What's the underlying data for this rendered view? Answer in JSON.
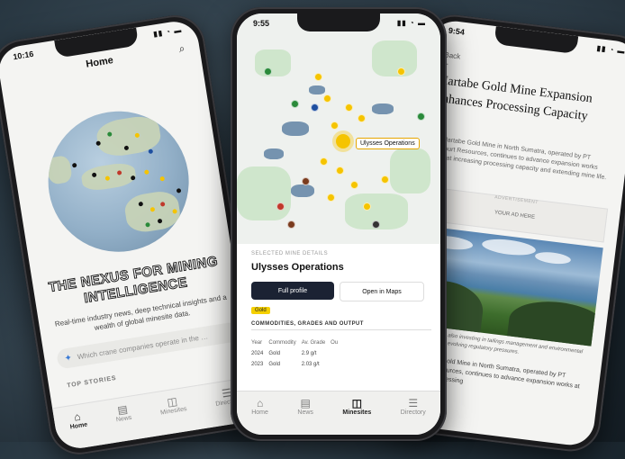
{
  "phone1": {
    "time": "10:16",
    "title": "Home",
    "hero": "THE NEXUS FOR MINING INTELLIGENCE",
    "subtitle": "Real-time industry news, deep technical insights and a wealth of global minesite data.",
    "ask_placeholder": "Which crane companies operate in the …",
    "top_stories": "TOP STORIES",
    "tabs": [
      "Home",
      "News",
      "Minesites",
      "Directory"
    ]
  },
  "phone2": {
    "time": "9:55",
    "callout": "Ulysses Operations",
    "selected_label": "SELECTED MINE DETAILS",
    "selected_title": "Ulysses Operations",
    "full_profile": "Full profile",
    "open_maps": "Open in Maps",
    "badge": "Gold",
    "section": "COMMODITIES, GRADES AND OUTPUT",
    "table": {
      "headers": [
        "Year",
        "Commodity",
        "Av. Grade",
        "Ou"
      ],
      "rows": [
        [
          "2024",
          "Gold",
          "2.9 g/t",
          ""
        ],
        [
          "2023",
          "Gold",
          "2.03 g/t",
          ""
        ]
      ]
    },
    "tabs": [
      "Home",
      "News",
      "Minesites",
      "Directory"
    ]
  },
  "phone3": {
    "time": "9:54",
    "back": "Back",
    "title": "Martabe Gold Mine Expansion Enhances Processing Capacity",
    "lede": "The Martabe Gold Mine in North Sumatra, operated by PT Agincourt Resources, continues to advance expansion works aimed at increasing processing capacity and extending mine life.",
    "ad_label": "ADVERTISEMENT",
    "ad_text": "YOUR AD HERE",
    "caption": "The operation is also investing in tailings management and environmental systems to meet evolving regulatory pressures.",
    "body": "The Martabe Gold Mine in North Sumatra, operated by PT Agincourt Resources, continues to advance expansion works at increasing processing"
  },
  "colors": {
    "accent_yellow": "#f5c400",
    "dark_button": "#1b2233"
  }
}
